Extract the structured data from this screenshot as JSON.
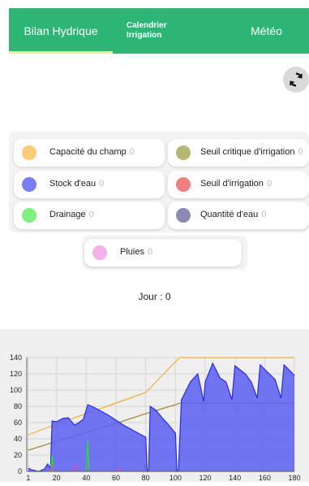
{
  "tabs": [
    {
      "label": "Bilan Hydrique"
    },
    {
      "label_line1": "Calendrier",
      "label_line2": "Irrigation"
    },
    {
      "label": "Météo"
    }
  ],
  "legend": [
    {
      "label": "Capacité du champ",
      "value": "0",
      "color": "#fbc977"
    },
    {
      "label": "Seuil critique d'irrigation",
      "value": "0",
      "color": "#b6b675"
    },
    {
      "label": "Stock d'eau",
      "value": "0",
      "color": "#7b7cf3"
    },
    {
      "label": "Seuil d'irrigation",
      "value": "0",
      "color": "#f07f7f"
    },
    {
      "label": "Drainage",
      "value": "0",
      "color": "#7ef07e"
    },
    {
      "label": "Quantité d'eau",
      "value": "0",
      "color": "#8a8ab2"
    },
    {
      "label": "Pluies",
      "value": "0",
      "color": "#f3b0ea"
    }
  ],
  "day": {
    "label": "Jour : 0"
  },
  "icons": {
    "refresh": "refresh-icon"
  },
  "chart_data": {
    "type": "area",
    "xlim": [
      0,
      180
    ],
    "ylim": [
      0,
      140
    ],
    "xticks": [
      1,
      20,
      40,
      60,
      80,
      100,
      120,
      140,
      160,
      180
    ],
    "yticks": [
      0,
      20,
      40,
      60,
      80,
      100,
      120,
      140
    ],
    "series": [
      {
        "color": "#f0b030",
        "points": [
          [
            1,
            45
          ],
          [
            20,
            58
          ],
          [
            40,
            71
          ],
          [
            60,
            84
          ],
          [
            80,
            97
          ],
          [
            100,
            135
          ],
          [
            103,
            140
          ],
          [
            180,
            140
          ]
        ]
      },
      {
        "color": "#a08a35",
        "points": [
          [
            1,
            26
          ],
          [
            20,
            37
          ],
          [
            40,
            48
          ],
          [
            60,
            59
          ],
          [
            80,
            71
          ],
          [
            100,
            82
          ],
          [
            103,
            84
          ],
          [
            180,
            84
          ]
        ]
      },
      {
        "color": "#2a2add",
        "fill": "#5a5ef0",
        "points": [
          [
            1,
            4
          ],
          [
            3,
            2
          ],
          [
            8,
            0
          ],
          [
            12,
            3
          ],
          [
            14,
            9
          ],
          [
            16,
            4
          ],
          [
            17,
            62
          ],
          [
            20,
            61
          ],
          [
            24,
            65
          ],
          [
            28,
            66
          ],
          [
            32,
            57
          ],
          [
            35,
            60
          ],
          [
            38,
            64
          ],
          [
            41,
            82
          ],
          [
            45,
            79
          ],
          [
            50,
            74
          ],
          [
            55,
            69
          ],
          [
            60,
            63
          ],
          [
            65,
            57
          ],
          [
            70,
            52
          ],
          [
            75,
            47
          ],
          [
            80,
            42
          ],
          [
            81,
            0
          ],
          [
            82,
            2
          ],
          [
            83,
            80
          ],
          [
            87,
            75
          ],
          [
            91,
            66
          ],
          [
            95,
            58
          ],
          [
            100,
            47
          ],
          [
            101,
            0
          ],
          [
            102,
            2
          ],
          [
            104,
            88
          ],
          [
            110,
            110
          ],
          [
            115,
            120
          ],
          [
            119,
            86
          ],
          [
            120,
            110
          ],
          [
            125,
            133
          ],
          [
            130,
            115
          ],
          [
            134,
            110
          ],
          [
            138,
            88
          ],
          [
            140,
            130
          ],
          [
            147,
            120
          ],
          [
            151,
            110
          ],
          [
            155,
            90
          ],
          [
            157,
            131
          ],
          [
            162,
            122
          ],
          [
            167,
            113
          ],
          [
            171,
            90
          ],
          [
            173,
            131
          ],
          [
            178,
            122
          ],
          [
            180,
            118
          ]
        ]
      },
      {
        "color": "#30e030",
        "points": [
          [
            1,
            0
          ],
          [
            16,
            0
          ],
          [
            17,
            20
          ],
          [
            18,
            0
          ],
          [
            40,
            0
          ],
          [
            41,
            38
          ],
          [
            42,
            0
          ],
          [
            180,
            0
          ]
        ]
      },
      {
        "color": "#e040d0",
        "points": [
          [
            1,
            0
          ],
          [
            15,
            0
          ],
          [
            17,
            6
          ],
          [
            19,
            0
          ],
          [
            30,
            0
          ],
          [
            33,
            8
          ],
          [
            35,
            0
          ],
          [
            60,
            0
          ],
          [
            62,
            4
          ],
          [
            64,
            0
          ],
          [
            180,
            0
          ]
        ]
      }
    ]
  }
}
